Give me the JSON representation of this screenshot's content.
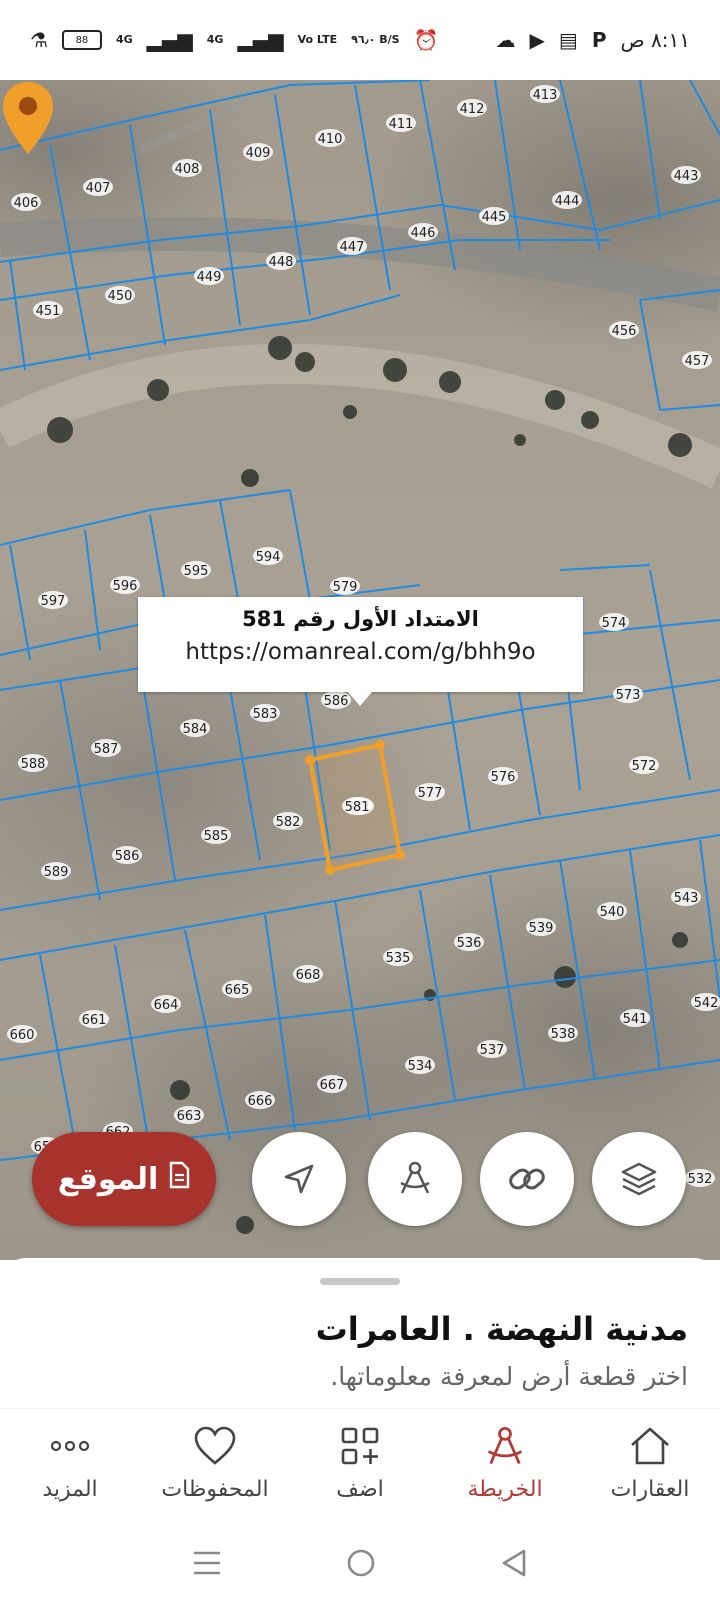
{
  "status_bar": {
    "time": "٨:١١ ص",
    "net1": "4G",
    "net2": "4G",
    "volte": "Vo LTE",
    "speed": "٩٦٫٠ B/S",
    "icons": [
      "flask-icon",
      "battery-icon",
      "alarm-icon",
      "cloud-icon",
      "youtube-icon",
      "sim-icon",
      "parking-icon"
    ]
  },
  "map": {
    "plots": [
      "406",
      "407",
      "408",
      "409",
      "410",
      "411",
      "412",
      "413",
      "443",
      "444",
      "445",
      "446",
      "447",
      "448",
      "449",
      "450",
      "451",
      "456",
      "457",
      "594",
      "595",
      "596",
      "597",
      "579",
      "574",
      "573",
      "572",
      "583",
      "584",
      "587",
      "588",
      "585",
      "586",
      "589",
      "582",
      "581",
      "577",
      "576",
      "586",
      "535",
      "536",
      "539",
      "540",
      "543",
      "668",
      "665",
      "664",
      "661",
      "660",
      "542",
      "541",
      "538",
      "537",
      "534",
      "667",
      "666",
      "663",
      "662",
      "659",
      "532"
    ],
    "callout_title": "الامتداد الأول رقم 581",
    "callout_url": "https://omanreal.com/g/bhh9o",
    "selected_plot": "581",
    "accent_color": "#f0a02a"
  },
  "actions": {
    "location_label": "الموقع",
    "location_color": "#a8332c",
    "fabs": [
      "navigate-icon",
      "measure-icon",
      "link-icon",
      "layers-icon"
    ]
  },
  "sheet": {
    "title": "مدنية النهضة . العامرات",
    "subtitle": "اختر قطعة أرض لمعرفة معلوماتها."
  },
  "nav": {
    "items": [
      {
        "label": "المزيد",
        "icon": "more-icon"
      },
      {
        "label": "المحفوظات",
        "icon": "heart-icon"
      },
      {
        "label": "اضف",
        "icon": "add-grid-icon"
      },
      {
        "label": "الخريطة",
        "icon": "compass-icon"
      },
      {
        "label": "العقارات",
        "icon": "home-icon"
      }
    ],
    "active_color": "#b33b35"
  }
}
